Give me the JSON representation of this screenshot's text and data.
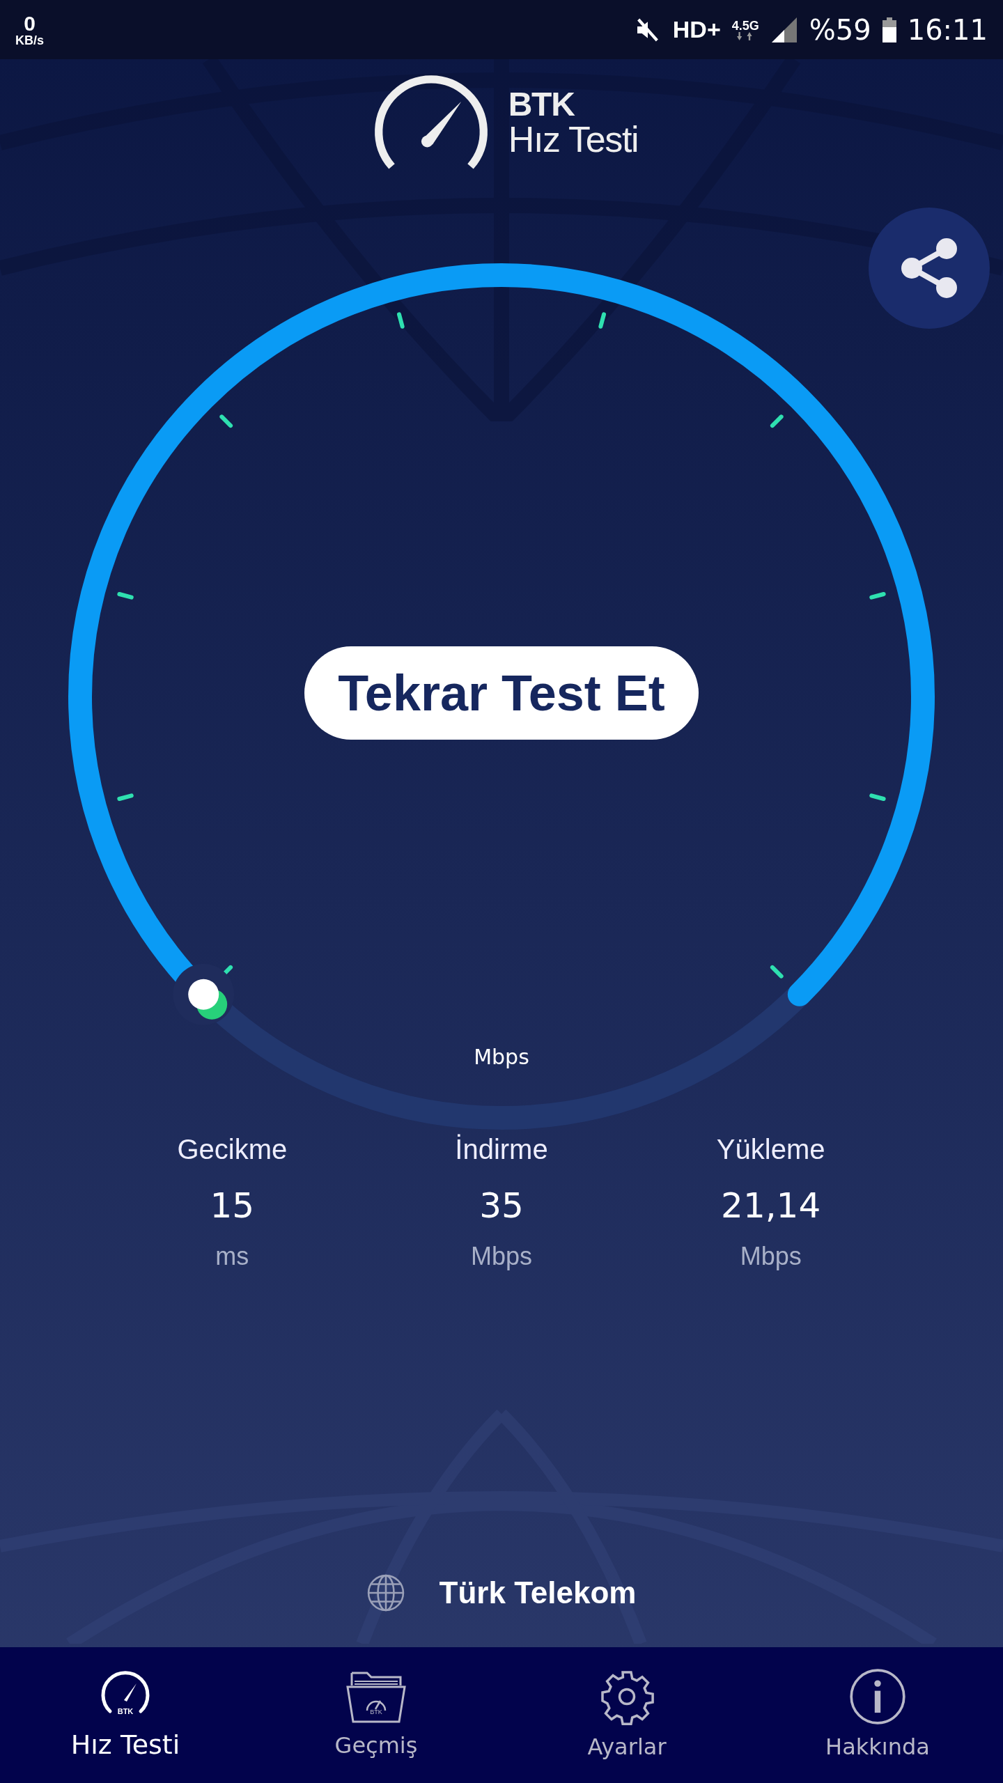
{
  "status_bar": {
    "speed": "0",
    "speed_unit": "KB/s",
    "network": "HD+",
    "network_type": "4.5G",
    "battery": "%59",
    "time": "16:11"
  },
  "logo": {
    "brand": "BTK",
    "title": "Hız Testi"
  },
  "gauge": {
    "unit": "Mbps",
    "button": "Tekrar Test Et"
  },
  "results": [
    {
      "label": "Gecikme",
      "value": "15",
      "unit": "ms"
    },
    {
      "label": "İndirme",
      "value": "35",
      "unit": "Mbps"
    },
    {
      "label": "Yükleme",
      "value": "21,14",
      "unit": "Mbps"
    }
  ],
  "operator": "Türk Telekom",
  "nav": [
    {
      "label": "Hız Testi",
      "badge": "BTK",
      "selected": true
    },
    {
      "label": "Geçmiş",
      "badge": "BTK",
      "selected": false
    },
    {
      "label": "Ayarlar",
      "selected": false
    },
    {
      "label": "Hakkında",
      "selected": false
    }
  ]
}
